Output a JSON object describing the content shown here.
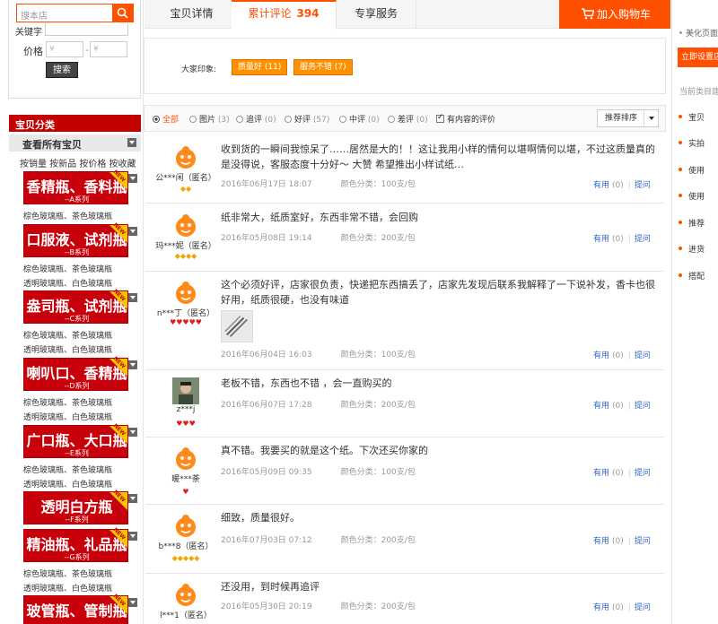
{
  "search": {
    "placeholder": "搜本店",
    "keyword_label": "关键字",
    "price_label": "价格",
    "price_min_placeholder": "¥",
    "price_max_placeholder": "¥",
    "price_dash": "-",
    "submit_label": "搜索"
  },
  "categories": {
    "title": "宝贝分类",
    "view_all": "查看所有宝贝",
    "sort_links": "按销量 按新品 按价格 按收藏",
    "new_badge": "NEW",
    "items": [
      {
        "title": "香精瓶、香料瓶",
        "series": "--A系列",
        "subs": [
          "棕色玻璃瓶、茶色玻璃瓶"
        ]
      },
      {
        "title": "口服液、试剂瓶",
        "series": "--B系列",
        "subs": [
          "棕色玻璃瓶、茶色玻璃瓶",
          "透明玻璃瓶、白色玻璃瓶"
        ]
      },
      {
        "title": "盎司瓶、试剂瓶",
        "series": "--C系列",
        "subs": [
          "棕色玻璃瓶、茶色玻璃瓶",
          "透明玻璃瓶、白色玻璃瓶"
        ]
      },
      {
        "title": "喇叭口、香精瓶",
        "series": "--D系列",
        "subs": [
          "棕色玻璃瓶、茶色玻璃瓶",
          "透明玻璃瓶、白色玻璃瓶"
        ]
      },
      {
        "title": "广口瓶、大口瓶",
        "series": "--E系列",
        "subs": [
          "棕色玻璃瓶、茶色玻璃瓶",
          "透明玻璃瓶、白色玻璃瓶"
        ]
      },
      {
        "title": "透明白方瓶",
        "series": "--F系列",
        "subs": []
      },
      {
        "title": "精油瓶、礼品瓶",
        "series": "--G系列",
        "subs": [
          "棕色玻璃瓶、茶色玻璃瓶",
          "透明玻璃瓶、白色玻璃瓶"
        ]
      },
      {
        "title": "玻管瓶、管制瓶",
        "series": "",
        "subs": []
      }
    ]
  },
  "tabs": {
    "details": "宝贝详情",
    "reviews": "累计评论",
    "reviews_count": "394",
    "services": "专享服务",
    "cart": "加入购物车"
  },
  "impressions": {
    "label": "大家印象:",
    "tags": [
      "质量好 (11)",
      "服务不错 (7)"
    ]
  },
  "filters": {
    "options": [
      {
        "label": "全部",
        "count": ""
      },
      {
        "label": "图片",
        "count": "(3)"
      },
      {
        "label": "追评",
        "count": "(0)"
      },
      {
        "label": "好评",
        "count": "(57)"
      },
      {
        "label": "中评",
        "count": "(0)"
      },
      {
        "label": "差评",
        "count": "(0)"
      }
    ],
    "with_content": "有内容的评价",
    "sort": "推荐排序"
  },
  "review_actions": {
    "useful": "有用",
    "useful_count": "(0)",
    "ask": "提问"
  },
  "reviews": [
    {
      "name": "公***闲（匿名）",
      "text": "收到货的一瞬间我惊呆了……居然是大的！！这让我用小样的情何以堪啊情何以堪，不过这质量真的是没得说，客服态度十分好～ 大赞 希望推出小样试纸…",
      "date": "2016年06月17日 18:07",
      "color": "颜色分类：100支/包",
      "rank_icon": "gold-diamond-icon",
      "rank_glyphs": "◆◆"
    },
    {
      "name": "玛***妮（匿名）",
      "text": "纸非常大，纸质室好，东西非常不错，会回购",
      "date": "2016年05月08日 19:14",
      "color": "颜色分类：200支/包",
      "rank_icon": "gold-diamond-icon",
      "rank_glyphs": "◆◆◆◆"
    },
    {
      "name": "n***丁（匿名）",
      "text": "这个必须好评，店家很负责，快递把东西搞丢了，店家先发现后联系我解释了一下说补发，香卡也很好用，纸质很硬，也没有味道",
      "date": "2016年06月04日 16:03",
      "color": "颜色分类：100支/包",
      "rank_icon": "red-heart-icon",
      "rank_glyphs": "♥♥♥♥♥"
    },
    {
      "name": "z***j",
      "text": "老板不错，东西也不错 ，会一直购买的",
      "date": "2016年06月07日 17:28",
      "color": "颜色分类：200支/包",
      "rank_icon": "red-heart-icon",
      "rank_glyphs": "♥♥♥"
    },
    {
      "name": "暖***荼",
      "text": "真不错。我要买的就是这个纸。下次还买你家的",
      "date": "2016年05月09日 09:35",
      "color": "颜色分类：100支/包",
      "rank_icon": "red-heart-icon",
      "rank_glyphs": "♥"
    },
    {
      "name": "b***8（匿名）",
      "text": "细致，质量很好。",
      "date": "2016年07月03日 07:12",
      "color": "颜色分类：200支/包",
      "rank_icon": "gold-diamond-icon",
      "rank_glyphs": "◆◆◆◆◆"
    },
    {
      "name": "l***1（匿名）",
      "text": "还没用，到时候再追评",
      "date": "2016年05月30日 20:19",
      "color": "颜色分类：200支/包",
      "rank_icon": "gold-diamond-icon",
      "rank_glyphs": ""
    }
  ],
  "right_sidebar": {
    "top_link": "美化页面",
    "setup_button": "立即设置店",
    "current_category": "当前类目建",
    "items": [
      "宝贝",
      "实拍",
      "使用",
      "使用",
      "推荐",
      "进货",
      "搭配"
    ]
  },
  "colors": {
    "accent": "#ff5000",
    "category_red": "#c8000c",
    "tag_orange": "#ff9000",
    "link_blue": "#3366cc"
  }
}
